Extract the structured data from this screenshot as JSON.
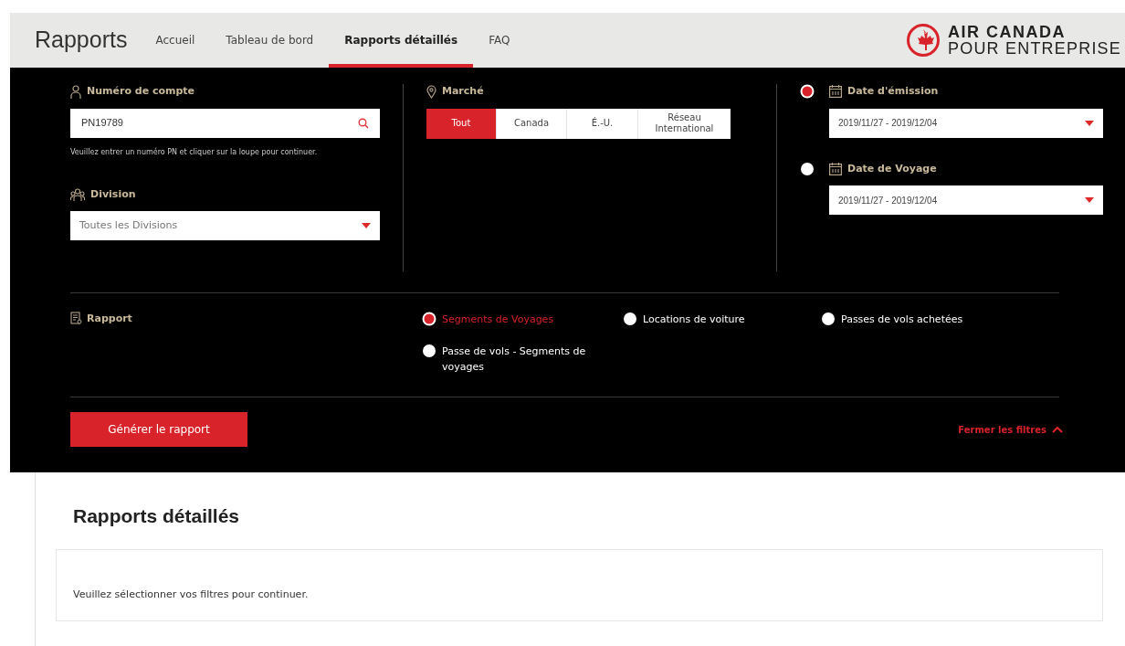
{
  "header": {
    "title": "Rapports",
    "nav": [
      {
        "label": "Accueil",
        "selected": false
      },
      {
        "label": "Tableau de bord",
        "selected": false
      },
      {
        "label": "Rapports détaillés",
        "selected": true
      },
      {
        "label": "FAQ",
        "selected": false
      }
    ],
    "logo": {
      "line1": "AIR CANADA",
      "line2": "POUR ENTREPRISE"
    }
  },
  "filters": {
    "account": {
      "label": "Numéro de compte",
      "value": "PN19789",
      "hint": "Veuillez entrer un numéro PN et cliquer sur la loupe pour continuer."
    },
    "division": {
      "label": "Division",
      "value": "Toutes les Divisions"
    },
    "market": {
      "label": "Marché",
      "options": [
        {
          "label": "Tout",
          "selected": true
        },
        {
          "label": "Canada",
          "selected": false
        },
        {
          "label": "É.-U.",
          "selected": false
        },
        {
          "label": "Réseau International",
          "selected": false
        }
      ]
    },
    "dates": [
      {
        "label": "Date d'émission",
        "value": "2019/11/27 - 2019/12/04",
        "selected": true
      },
      {
        "label": "Date de Voyage",
        "value": "2019/11/27 - 2019/12/04",
        "selected": false
      }
    ],
    "report": {
      "label": "Rapport",
      "options": [
        {
          "label": "Segments de Voyages",
          "selected": true
        },
        {
          "label": "Locations de voiture",
          "selected": false
        },
        {
          "label": "Passes de vols achetées",
          "selected": false
        },
        {
          "label": "Passe de vols - Segments de voyages",
          "selected": false
        }
      ]
    },
    "generate_button": "Générer le rapport",
    "close_filters": "Fermer les filtres"
  },
  "content": {
    "heading": "Rapports détaillés",
    "message": "Veuillez sélectionner vos filtres pour continuer."
  }
}
